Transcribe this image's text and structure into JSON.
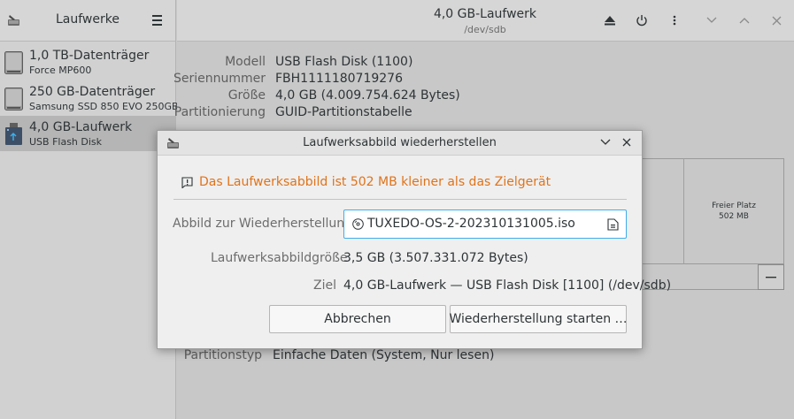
{
  "sidebar": {
    "title": "Laufwerke",
    "drives": [
      {
        "name": "1,0 TB-Datenträger",
        "sub": "Force MP600",
        "selected": false,
        "icon": "hard-disk-icon"
      },
      {
        "name": "250 GB-Datenträger",
        "sub": "Samsung SSD 850 EVO 250GB",
        "selected": false,
        "icon": "hard-disk-icon"
      },
      {
        "name": "4,0 GB-Laufwerk",
        "sub": "USB Flash Disk",
        "selected": true,
        "icon": "usb-drive-icon"
      }
    ]
  },
  "header": {
    "title": "4,0 GB-Laufwerk",
    "subtitle": "/dev/sdb"
  },
  "info": {
    "model_label": "Modell",
    "model_value": "USB Flash Disk (1100)",
    "serial_label": "Seriennummer",
    "serial_value": "FBH1111180719276",
    "size_label": "Größe",
    "size_value": "4,0 GB (4.009.754.624 Bytes)",
    "partitioning_label": "Partitionierung",
    "partitioning_value": "GUID-Partitionstabelle",
    "parttype_label": "Partitionstyp",
    "parttype_value": "Einfache Daten (System, Nur lesen)"
  },
  "volumes": {
    "free_label": "Freier Platz",
    "free_size": "502 MB"
  },
  "dialog": {
    "title": "Laufwerksabbild wiederherstellen",
    "warning": "Das Laufwerksabbild ist 502 MB kleiner als das Zielgerät",
    "image_label": "Abbild zur Wiederherstellung",
    "image_file": "TUXEDO-OS-2-202310131005.iso",
    "size_label": "Laufwerksabbildgröße",
    "size_value": "3,5 GB (3.507.331.072 Bytes)",
    "target_label": "Ziel",
    "target_value": "4,0 GB-Laufwerk — USB Flash Disk [1100] (/dev/sdb)",
    "cancel_label": "Abbrechen",
    "start_label": "Wiederherstellung starten …"
  },
  "colors": {
    "warning": "#e0731a",
    "focus": "#3daee9"
  }
}
